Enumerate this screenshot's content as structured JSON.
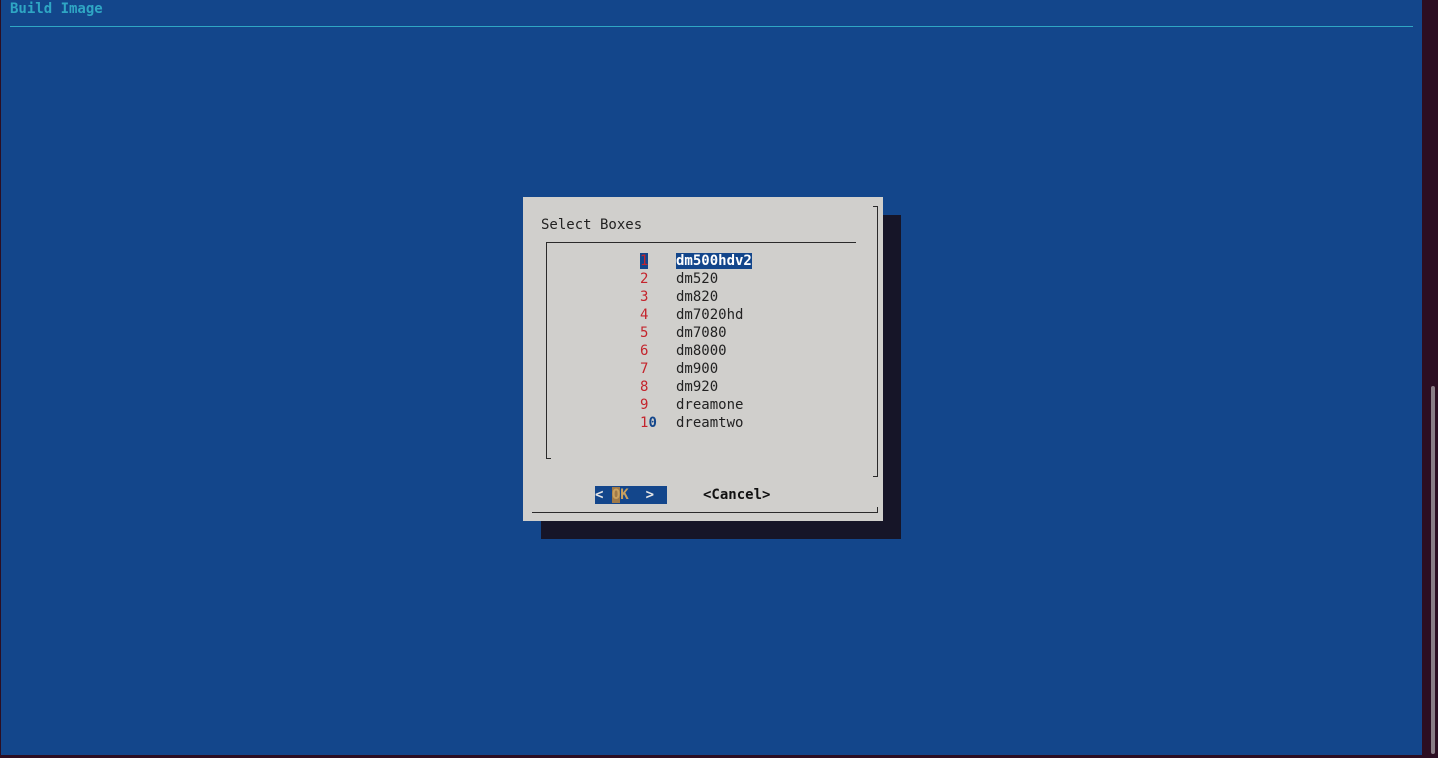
{
  "backtitle": "Build Image",
  "dialog": {
    "title": "Select Boxes",
    "selected_index": 0,
    "items": [
      {
        "tag": "1",
        "label": "dm500hdv2"
      },
      {
        "tag": "2",
        "label": "dm520"
      },
      {
        "tag": "3",
        "label": "dm820"
      },
      {
        "tag": "4",
        "label": "dm7020hd"
      },
      {
        "tag": "5",
        "label": "dm7080"
      },
      {
        "tag": "6",
        "label": "dm8000"
      },
      {
        "tag": "7",
        "label": "dm900"
      },
      {
        "tag": "8",
        "label": "dm920"
      },
      {
        "tag": "9",
        "label": "dreamone"
      },
      {
        "tag": "10",
        "label": "dreamtwo"
      }
    ],
    "buttons": {
      "ok_left": "< ",
      "ok_hot": "O",
      "ok_rest": "K",
      "ok_right": "  >",
      "cancel": "<Cancel>"
    }
  },
  "colors": {
    "terminal_bg": "#13468b",
    "dialog_bg": "#d0cfcc",
    "shadow": "#161528",
    "backtitle": "#2fa6c4",
    "tag_red": "#c4242c",
    "selection_bg": "#13468b"
  }
}
